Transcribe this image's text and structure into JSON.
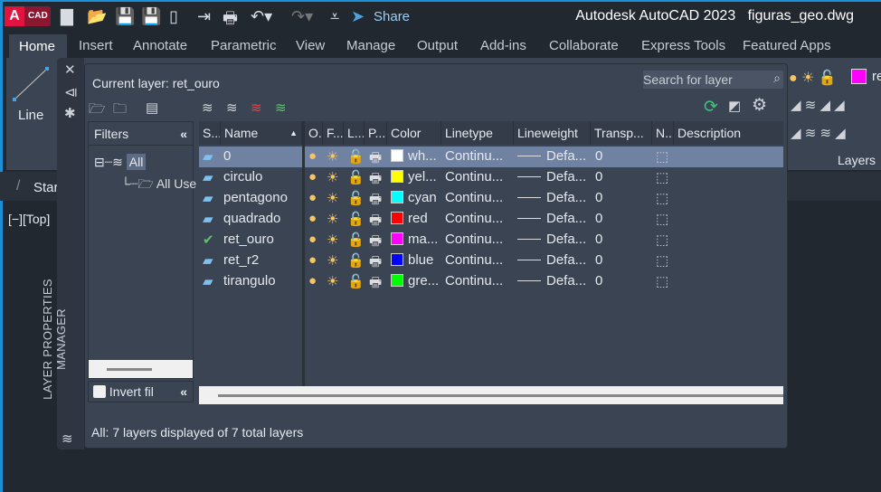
{
  "app": {
    "logo_text": "CAD",
    "share_label": "Share",
    "title": "Autodesk AutoCAD 2023",
    "filename": "figuras_geo.dwg"
  },
  "ribbon_tabs": [
    "Home",
    "Insert",
    "Annotate",
    "Parametric",
    "View",
    "Manage",
    "Output",
    "Add-ins",
    "Collaborate",
    "Express Tools",
    "Featured Apps"
  ],
  "ribbon": {
    "line_label": "Line",
    "layers_label": "Layers",
    "current_layer_preview": "re"
  },
  "file_tab": "Star",
  "viewport_label": "[−][Top]",
  "palette": {
    "side_title": "LAYER PROPERTIES MANAGER",
    "current_layer": "Current layer: ret_ouro",
    "search_placeholder": "Search for layer",
    "filters_title": "Filters",
    "filter_tree": [
      "All",
      "All Use"
    ],
    "invert_filter": "Invert fil",
    "status": "All: 7 layers displayed of 7 total layers",
    "columns": [
      "S...",
      "Name",
      "O..",
      "F...",
      "L...",
      "P...",
      "Color",
      "Linetype",
      "Lineweight",
      "Transp...",
      "N..",
      "Description"
    ],
    "layers": [
      {
        "name": "0",
        "color": "wh...",
        "hex": "#ffffff",
        "linetype": "Continu...",
        "lineweight": "Defa...",
        "transparency": "0",
        "current": false
      },
      {
        "name": "circulo",
        "color": "yel...",
        "hex": "#ffff00",
        "linetype": "Continu...",
        "lineweight": "Defa...",
        "transparency": "0",
        "current": false
      },
      {
        "name": "pentagono",
        "color": "cyan",
        "hex": "#00ffff",
        "linetype": "Continu...",
        "lineweight": "Defa...",
        "transparency": "0",
        "current": false
      },
      {
        "name": "quadrado",
        "color": "red",
        "hex": "#ff0000",
        "linetype": "Continu...",
        "lineweight": "Defa...",
        "transparency": "0",
        "current": false
      },
      {
        "name": "ret_ouro",
        "color": "ma...",
        "hex": "#ff00ff",
        "linetype": "Continu...",
        "lineweight": "Defa...",
        "transparency": "0",
        "current": true
      },
      {
        "name": "ret_r2",
        "color": "blue",
        "hex": "#0000ff",
        "linetype": "Continu...",
        "lineweight": "Defa...",
        "transparency": "0",
        "current": false
      },
      {
        "name": "tirangulo",
        "color": "gre...",
        "hex": "#00ff00",
        "linetype": "Continu...",
        "lineweight": "Defa...",
        "transparency": "0",
        "current": false
      }
    ]
  }
}
